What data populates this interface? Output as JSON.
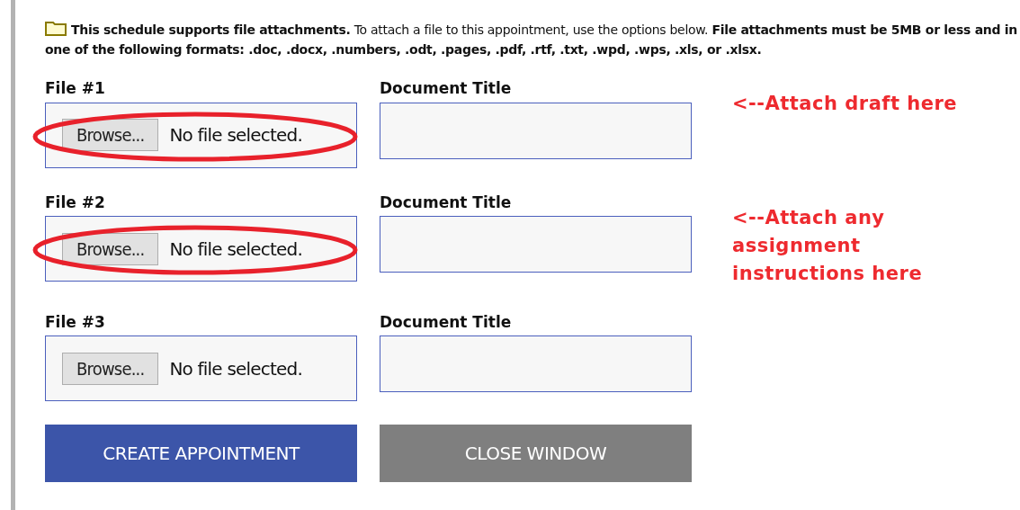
{
  "intro": "**This schedule supports file attachments.** To attach a file to this appointment, use the options below. **File attachments must be 5MB or less and in one of the following formats: .doc, .docx, .numbers, .odt, .pages, .pdf, .rtf, .txt, .wpd, .wps, .xls, or .xlsx.**",
  "files": [
    {
      "label": "File #1",
      "button": "Browse...",
      "status": "No file selected.",
      "title_label": "Document Title",
      "circled": true,
      "note": "<--Attach draft here"
    },
    {
      "label": "File #2",
      "button": "Browse...",
      "status": "No file selected.",
      "title_label": "Document Title",
      "circled": true,
      "note": "<--Attach any assignment instructions here"
    },
    {
      "label": "File #3",
      "button": "Browse...",
      "status": "No file selected.",
      "title_label": "Document Title",
      "circled": false
    }
  ],
  "buttons": [
    {
      "label": "CREATE APPOINTMENT",
      "kind": "primary"
    },
    {
      "label": "CLOSE WINDOW",
      "kind": "secondary"
    }
  ]
}
